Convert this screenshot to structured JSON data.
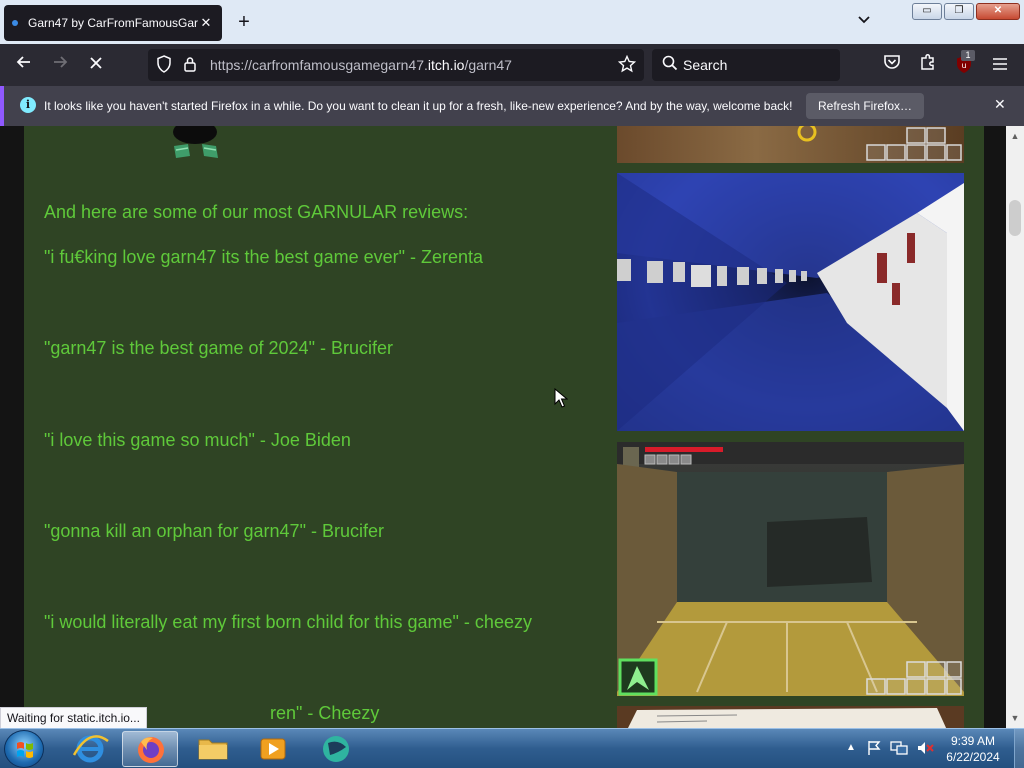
{
  "browser": {
    "tab": {
      "title": "Garn47 by CarFromFamousGar",
      "close": "✕"
    },
    "new_tab": "+",
    "tab_list": "⌄",
    "url": {
      "prefix": "https://carfromfamousgamegarn47.",
      "host": "itch.io",
      "path": "/garn47"
    },
    "search_placeholder": "Search",
    "ublock_badge": "1",
    "window_buttons": {
      "minimize": "▭",
      "maximize": "❐",
      "close": "✕"
    }
  },
  "notification": {
    "info_glyph": "i",
    "message": "It looks like you haven't started Firefox in a while. Do you want to clean it up for a fresh, like-new experience? And by the way, welcome back!",
    "button": "Refresh Firefox…",
    "close": "✕"
  },
  "page": {
    "intro": "And here are some of our most GARNULAR reviews:",
    "reviews": [
      "\"i fu€king love garn47 its the best game ever\" - Zerenta",
      "\"garn47 is the best game of 2024\" - Brucifer",
      "\"i love this game so much\" - Joe Biden",
      "\"gonna kill an orphan for garn47\" - Brucifer",
      "\"i would literally eat my first born child for this game\" - cheezy",
      "ren\" - Cheezy"
    ],
    "text_color": "#5fc93a",
    "background_color": "#2f4424"
  },
  "status_bar": "Waiting for static.itch.io...",
  "taskbar": {
    "time": "9:39 AM",
    "date": "6/22/2024"
  }
}
